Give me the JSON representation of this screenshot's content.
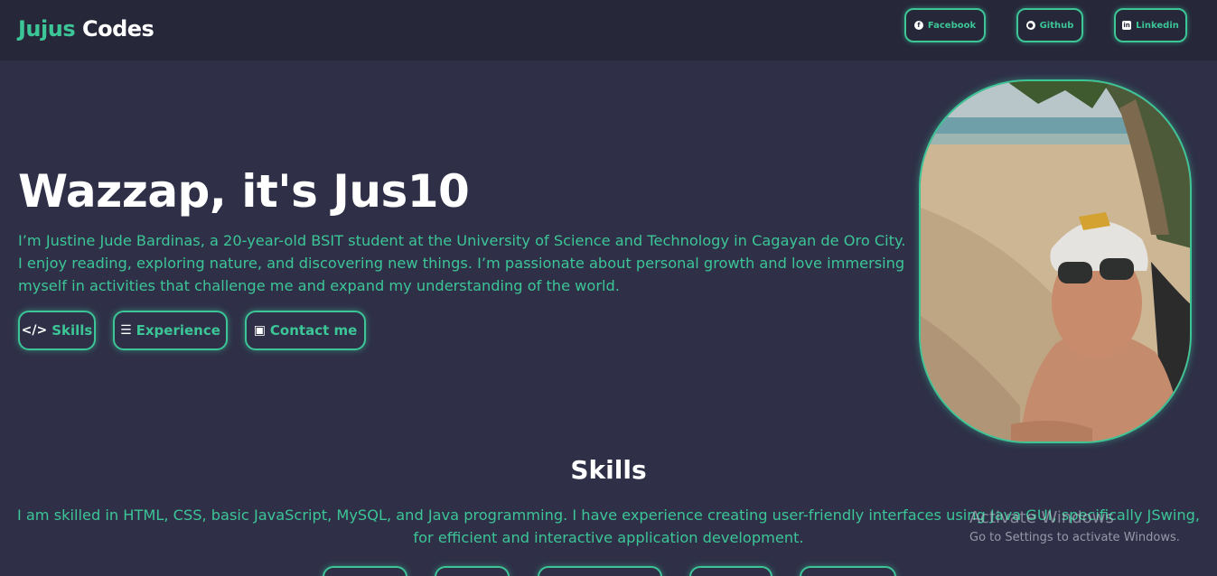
{
  "navbar": {
    "brand_accent": "Jujus",
    "brand_rest": "Codes",
    "links": [
      {
        "label": "Facebook",
        "icon": "facebook-icon"
      },
      {
        "label": "Github",
        "icon": "github-icon"
      },
      {
        "label": "Linkedin",
        "icon": "linkedin-icon"
      }
    ]
  },
  "hero": {
    "title": "Wazzap, it's Jus10",
    "description": "I’m Justine Jude Bardinas, a 20-year-old BSIT student at the University of Science and Technology in Cagayan de Oro City. I enjoy reading, exploring nature, and discovering new things. I’m passionate about personal growth and love immersing myself in activities that challenge me and expand my understanding of the world.",
    "buttons": [
      {
        "label": "Skills",
        "icon": "code-icon"
      },
      {
        "label": "Experience",
        "icon": "list-check-icon"
      },
      {
        "label": "Contact me",
        "icon": "contact-card-icon"
      }
    ]
  },
  "skills": {
    "title": "Skills",
    "description": "I am skilled in HTML, CSS, basic JavaScript, MySQL, and Java programming. I have experience creating user-friendly interfaces using Java GUI, specifically JSwing, for efficient and interactive application development."
  },
  "watermark": {
    "title": "Activate Windows",
    "subtitle": "Go to Settings to activate Windows."
  },
  "colors": {
    "background": "#2f3048",
    "navbar": "#262739",
    "accent": "#3cc596",
    "text": "#ffffff"
  }
}
